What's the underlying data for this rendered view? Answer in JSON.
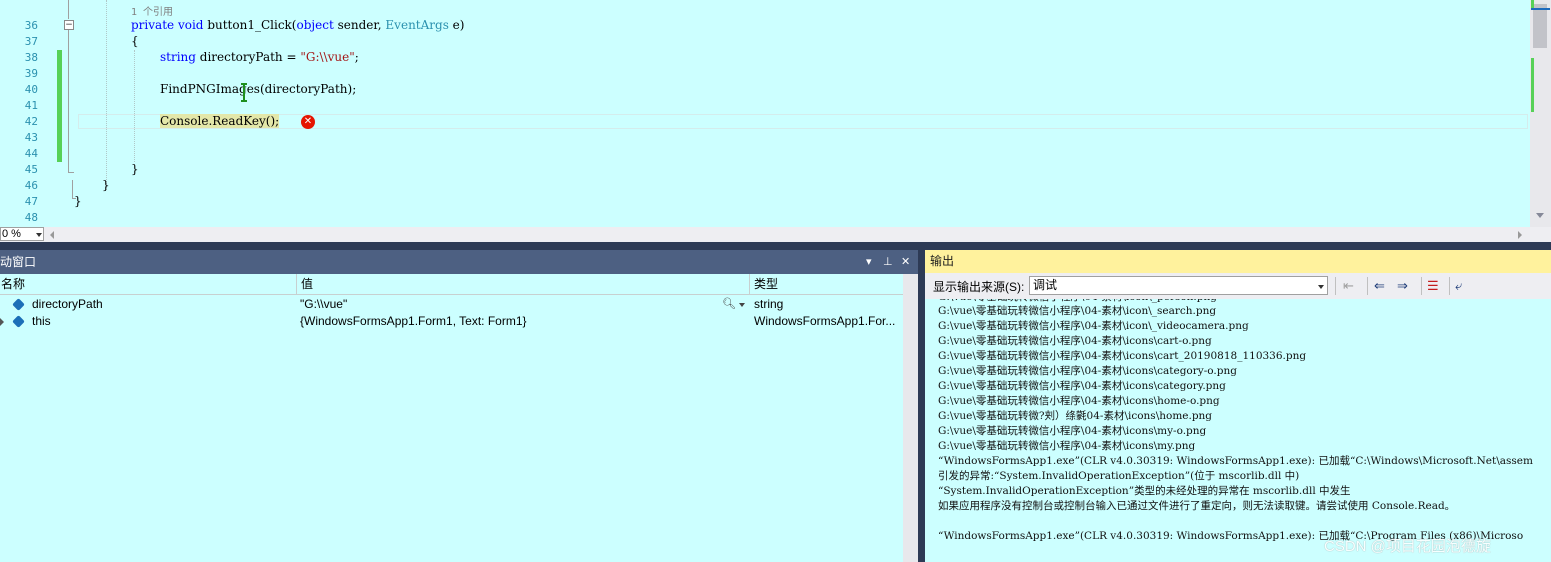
{
  "editor": {
    "ref_hint": "1 个引用",
    "line_numbers": [
      "36",
      "37",
      "38",
      "39",
      "40",
      "41",
      "42",
      "43",
      "44",
      "45",
      "46",
      "47",
      "48"
    ],
    "code": {
      "l36": {
        "kw1": "private",
        "kw2": "void",
        "name": "button1_Click(",
        "kw3": "object",
        "p1": " sender, ",
        "ty": "EventArgs",
        "p2": " e)"
      },
      "l37": "{",
      "l38": {
        "kw": "string",
        "mid": " directoryPath = ",
        "str": "\"G:\\\\vue\"",
        "end": ";"
      },
      "l40": "FindPNGImages(directoryPath);",
      "l42": "Console.ReadKey();",
      "l45": "}",
      "l46": "}",
      "l47": "}"
    },
    "error_glyph": "✕",
    "zoom": "0 %"
  },
  "autos": {
    "title": "动窗口",
    "title_buttons": {
      "dropdown": "▾",
      "pin": "⊥",
      "close": "✕"
    },
    "columns": {
      "name": "名称",
      "value": "值",
      "type": "类型"
    },
    "rows": [
      {
        "name": "directoryPath",
        "value": "\"G:\\\\vue\"",
        "type": "string"
      },
      {
        "name": "this",
        "value": "{WindowsFormsApp1.Form1, Text: Form1}",
        "type": "WindowsFormsApp1.For..."
      }
    ]
  },
  "output": {
    "title": "输出",
    "source_label": "显示输出来源(S):",
    "source_value": "调试",
    "lines": [
      "G:\\vue\\零基础玩转微信小程序\\04-素材\\icon\\_search.png",
      "G:\\vue\\零基础玩转微信小程序\\04-素材\\icon\\_videocamera.png",
      "G:\\vue\\零基础玩转微信小程序\\04-素材\\icons\\cart-o.png",
      "G:\\vue\\零基础玩转微信小程序\\04-素材\\icons\\cart_20190818_110336.png",
      "G:\\vue\\零基础玩转微信小程序\\04-素材\\icons\\category-o.png",
      "G:\\vue\\零基础玩转微信小程序\\04-素材\\icons\\category.png",
      "G:\\vue\\零基础玩转微信小程序\\04-素材\\icons\\home-o.png",
      "G:\\vue\\零基础玩转微?刾）绦氋04-素材\\icons\\home.png",
      "G:\\vue\\零基础玩转微信小程序\\04-素材\\icons\\my-o.png",
      "G:\\vue\\零基础玩转微信小程序\\04-素材\\icons\\my.png",
      "“WindowsFormsApp1.exe”(CLR v4.0.30319: WindowsFormsApp1.exe): 已加载“C:\\Windows\\Microsoft.Net\\assem",
      "引发的异常:“System.InvalidOperationException”(位于 mscorlib.dll 中)",
      "“System.InvalidOperationException”类型的未经处理的异常在 mscorlib.dll 中发生",
      "如果应用程序没有控制台或控制台输入已通过文件进行了重定向，则无法读取键。请尝试使用 Console.Read。",
      "",
      "“WindowsFormsApp1.exe”(CLR v4.0.30319: WindowsFormsApp1.exe): 已加载“C:\\Program Files (x86)\\Microso"
    ],
    "toolbar_icons": [
      "clear-all-icon",
      "go-to-previous-icon",
      "go-to-next-icon",
      "clear-icon",
      "word-wrap-icon"
    ]
  },
  "watermark": "CSDN @项目花园泡德旋",
  "colors": {
    "editor_bg": "#ccffff",
    "keyword": "#0000ff",
    "type": "#2b91af",
    "string": "#a31515",
    "pane_title": "#4d6082",
    "output_title": "#fff29d",
    "error": "#e51400"
  }
}
